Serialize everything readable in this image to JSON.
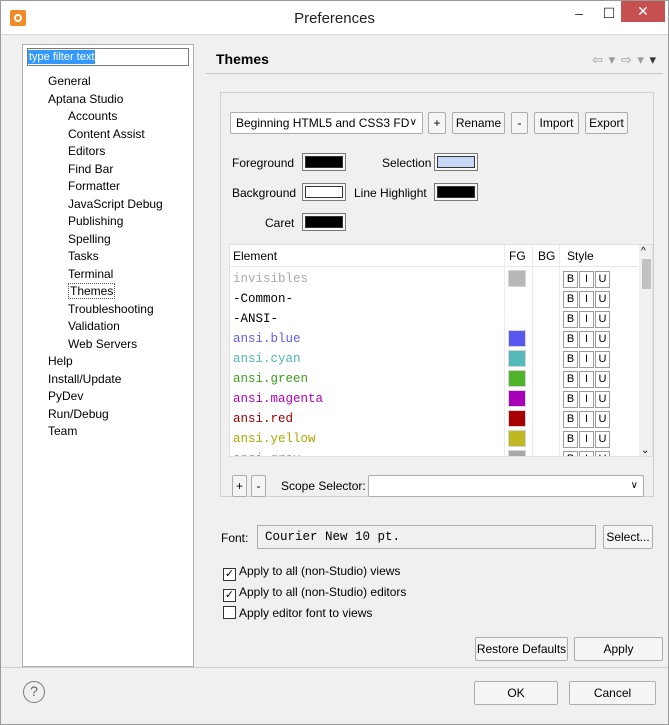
{
  "window": {
    "title": "Preferences",
    "min_glyph": "–",
    "max_glyph": "☐",
    "close_glyph": "✕"
  },
  "left": {
    "filter_placeholder": "type filter text",
    "tree": [
      {
        "label": "General",
        "level": 0
      },
      {
        "label": "Aptana Studio",
        "level": 0
      },
      {
        "label": "Accounts",
        "level": 1
      },
      {
        "label": "Content Assist",
        "level": 1
      },
      {
        "label": "Editors",
        "level": 1
      },
      {
        "label": "Find Bar",
        "level": 1
      },
      {
        "label": "Formatter",
        "level": 1
      },
      {
        "label": "JavaScript Debug",
        "level": 1
      },
      {
        "label": "Publishing",
        "level": 1
      },
      {
        "label": "Spelling",
        "level": 1
      },
      {
        "label": "Tasks",
        "level": 1
      },
      {
        "label": "Terminal",
        "level": 1
      },
      {
        "label": "Themes",
        "level": 1,
        "selected": true
      },
      {
        "label": "Troubleshooting",
        "level": 1
      },
      {
        "label": "Validation",
        "level": 1
      },
      {
        "label": "Web Servers",
        "level": 1
      },
      {
        "label": "Help",
        "level": 0
      },
      {
        "label": "Install/Update",
        "level": 0
      },
      {
        "label": "PyDev",
        "level": 0
      },
      {
        "label": "Run/Debug",
        "level": 0
      },
      {
        "label": "Team",
        "level": 0
      }
    ]
  },
  "header": {
    "title": "Themes",
    "back": "⇦ ▾",
    "forward": "⇨ ▾",
    "menu": "▾"
  },
  "themes": {
    "theme_selected": "Beginning HTML5 and CSS3 FD",
    "add_label": "+",
    "rename_label": "Rename",
    "remove_label": "-",
    "import_label": "Import",
    "export_label": "Export",
    "foreground_label": "Foreground",
    "background_label": "Background",
    "caret_label": "Caret",
    "selection_label": "Selection",
    "line_highlight_label": "Line Highlight",
    "colors": {
      "foreground": "#000000",
      "background": "#ffffff",
      "caret": "#000000",
      "selection": "#c5d8f7",
      "line_highlight": "#000000"
    }
  },
  "table": {
    "headers": {
      "element": "Element",
      "fg": "FG",
      "bg": "BG",
      "style": "Style"
    },
    "style_buttons": {
      "b": "B",
      "i": "I",
      "u": "U"
    },
    "rows": [
      {
        "name": "invisibles",
        "color": "#aaaaaa",
        "fg": "#b8b8b8"
      },
      {
        "name": "-Common-",
        "color": "#000000",
        "fg": ""
      },
      {
        "name": "-ANSI-",
        "color": "#000000",
        "fg": ""
      },
      {
        "name": "ansi.blue",
        "color": "#5b5bef",
        "fg": "#5858ee"
      },
      {
        "name": "ansi.cyan",
        "color": "#4fb4b4",
        "fg": "#56b9b9"
      },
      {
        "name": "ansi.green",
        "color": "#3f9e1f",
        "fg": "#4fb42a"
      },
      {
        "name": "ansi.magenta",
        "color": "#b000b8",
        "fg": "#a800b8"
      },
      {
        "name": "ansi.red",
        "color": "#a00000",
        "fg": "#a80000"
      },
      {
        "name": "ansi.yellow",
        "color": "#a8a800",
        "fg": "#c0b820"
      },
      {
        "name": "ansi.gray",
        "color": "#9a9a9a",
        "fg": "#a8a8a8"
      }
    ]
  },
  "scope": {
    "add_label": "+",
    "remove_label": "-",
    "label": "Scope Selector:",
    "value": ""
  },
  "font": {
    "label": "Font:",
    "value": "Courier New 10 pt.",
    "select_label": "Select..."
  },
  "options": [
    {
      "label": "Apply to all (non-Studio) views",
      "checked": true
    },
    {
      "label": "Apply to all (non-Studio) editors",
      "checked": true
    },
    {
      "label": "Apply editor font to views",
      "checked": false
    }
  ],
  "buttons": {
    "restore_defaults": "Restore Defaults",
    "apply": "Apply",
    "ok": "OK",
    "cancel": "Cancel"
  },
  "help": {
    "glyph": "?"
  }
}
